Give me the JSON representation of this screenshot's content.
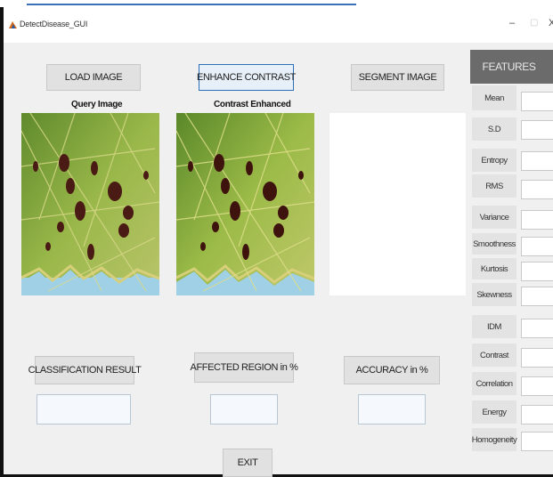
{
  "window": {
    "title": "DetectDisease_GUI",
    "minimize_glyph": "–",
    "maximize_glyph": "▢",
    "close_glyph": "X"
  },
  "buttons": {
    "load_image": "LOAD IMAGE",
    "enhance_contrast": "ENHANCE CONTRAST",
    "segment_image": "SEGMENT IMAGE",
    "classification_result": "CLASSIFICATION RESULT",
    "affected_region": "AFFECTED REGION in %",
    "accuracy": "ACCURACY in %",
    "exit": "EXIT"
  },
  "captions": {
    "query_image": "Query Image",
    "contrast_enhanced": "Contrast Enhanced"
  },
  "features": {
    "header": "FEATURES",
    "items": [
      {
        "label": "Mean",
        "value": ""
      },
      {
        "label": "S.D",
        "value": ""
      },
      {
        "label": "Entropy",
        "value": ""
      },
      {
        "label": "RMS",
        "value": ""
      },
      {
        "label": "Variance",
        "value": ""
      },
      {
        "label": "Smoothness",
        "value": ""
      },
      {
        "label": "Kurtosis",
        "value": ""
      },
      {
        "label": "Skewness",
        "value": ""
      },
      {
        "label": "IDM",
        "value": ""
      },
      {
        "label": "Contrast",
        "value": ""
      },
      {
        "label": "Correlation",
        "value": ""
      },
      {
        "label": "Energy",
        "value": ""
      },
      {
        "label": "Homogeneity",
        "value": ""
      }
    ]
  },
  "results": {
    "classification": "",
    "affected_region": "",
    "accuracy": ""
  },
  "colors": {
    "panel_bg": "#f0f0f0",
    "button_bg": "#e1e1e1",
    "active_border": "#2f6fb7",
    "features_header_bg": "#6b6b6b",
    "leaf_green": "#8fb040",
    "lesion": "#4a1a14",
    "water_blue": "#9fd0e6"
  }
}
